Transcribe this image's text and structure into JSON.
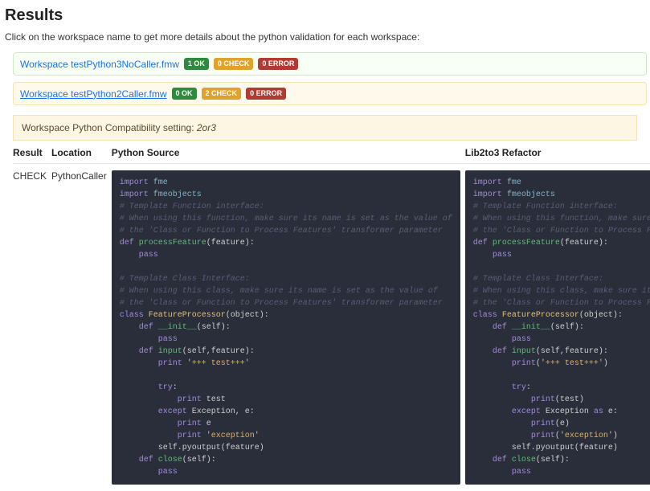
{
  "page": {
    "title": "Results",
    "subtitle": "Click on the workspace name to get more details about the python validation for each workspace:"
  },
  "workspaces": [
    {
      "name": "Workspace testPython3NoCaller.fmw",
      "ok": "1 OK",
      "check": "0 CHECK",
      "error": "0 ERROR",
      "style": "ok"
    },
    {
      "name": "Workspace testPython2Caller.fmw",
      "ok": "0 OK",
      "check": "2 CHECK",
      "error": "0 ERROR",
      "style": "warn"
    }
  ],
  "compat": {
    "label": "Workspace Python Compatibility setting: ",
    "value": "2or3"
  },
  "table": {
    "headers": {
      "result": "Result",
      "location": "Location",
      "source": "Python Source",
      "refactor": "Lib2to3 Refactor"
    },
    "rows": [
      {
        "result": "CHECK",
        "location": "PythonCaller",
        "source": [
          {
            "t": "key",
            "v": "import "
          },
          {
            "t": "mod",
            "v": "fme"
          },
          {
            "t": "nl"
          },
          {
            "t": "key",
            "v": "import "
          },
          {
            "t": "mod",
            "v": "fmeobjects"
          },
          {
            "t": "nl"
          },
          {
            "t": "com",
            "v": "# Template Function interface:"
          },
          {
            "t": "nl"
          },
          {
            "t": "com",
            "v": "# When using this function, make sure its name is set as the value of"
          },
          {
            "t": "nl"
          },
          {
            "t": "com",
            "v": "# the 'Class or Function to Process Features' transformer parameter"
          },
          {
            "t": "nl"
          },
          {
            "t": "def",
            "v": "def "
          },
          {
            "t": "fn",
            "v": "processFeature"
          },
          {
            "t": "",
            "v": "(feature):"
          },
          {
            "t": "nl"
          },
          {
            "t": "",
            "v": "    "
          },
          {
            "t": "key",
            "v": "pass"
          },
          {
            "t": "nl"
          },
          {
            "t": "nl"
          },
          {
            "t": "com",
            "v": "# Template Class Interface:"
          },
          {
            "t": "nl"
          },
          {
            "t": "com",
            "v": "# When using this class, make sure its name is set as the value of"
          },
          {
            "t": "nl"
          },
          {
            "t": "com",
            "v": "# the 'Class or Function to Process Features' transformer parameter"
          },
          {
            "t": "nl"
          },
          {
            "t": "key",
            "v": "class "
          },
          {
            "t": "cls",
            "v": "FeatureProcessor"
          },
          {
            "t": "",
            "v": "(object):"
          },
          {
            "t": "nl"
          },
          {
            "t": "",
            "v": "    "
          },
          {
            "t": "def",
            "v": "def "
          },
          {
            "t": "fn",
            "v": "__init__"
          },
          {
            "t": "",
            "v": "(self):"
          },
          {
            "t": "nl"
          },
          {
            "t": "",
            "v": "        "
          },
          {
            "t": "key",
            "v": "pass"
          },
          {
            "t": "nl"
          },
          {
            "t": "",
            "v": "    "
          },
          {
            "t": "def",
            "v": "def "
          },
          {
            "t": "fn",
            "v": "input"
          },
          {
            "t": "",
            "v": "(self,feature):"
          },
          {
            "t": "nl"
          },
          {
            "t": "",
            "v": "        "
          },
          {
            "t": "key",
            "v": "print "
          },
          {
            "t": "str",
            "v": "'+++ test+++'"
          },
          {
            "t": "nl"
          },
          {
            "t": "nl"
          },
          {
            "t": "",
            "v": "        "
          },
          {
            "t": "key",
            "v": "try"
          },
          {
            "t": "",
            "v": ":"
          },
          {
            "t": "nl"
          },
          {
            "t": "",
            "v": "            "
          },
          {
            "t": "key",
            "v": "print "
          },
          {
            "t": "",
            "v": "test"
          },
          {
            "t": "nl"
          },
          {
            "t": "",
            "v": "        "
          },
          {
            "t": "key",
            "v": "except"
          },
          {
            "t": "",
            "v": " Exception, e:"
          },
          {
            "t": "nl"
          },
          {
            "t": "",
            "v": "            "
          },
          {
            "t": "key",
            "v": "print "
          },
          {
            "t": "",
            "v": "e"
          },
          {
            "t": "nl"
          },
          {
            "t": "",
            "v": "            "
          },
          {
            "t": "key",
            "v": "print "
          },
          {
            "t": "str",
            "v": "'exception'"
          },
          {
            "t": "nl"
          },
          {
            "t": "",
            "v": "        self.pyoutput(feature)"
          },
          {
            "t": "nl"
          },
          {
            "t": "",
            "v": "    "
          },
          {
            "t": "def",
            "v": "def "
          },
          {
            "t": "fn",
            "v": "close"
          },
          {
            "t": "",
            "v": "(self):"
          },
          {
            "t": "nl"
          },
          {
            "t": "",
            "v": "        "
          },
          {
            "t": "key",
            "v": "pass"
          }
        ],
        "refactor": [
          {
            "t": "key",
            "v": "import "
          },
          {
            "t": "mod",
            "v": "fme"
          },
          {
            "t": "nl"
          },
          {
            "t": "key",
            "v": "import "
          },
          {
            "t": "mod",
            "v": "fmeobjects"
          },
          {
            "t": "nl"
          },
          {
            "t": "com",
            "v": "# Template Function interface:"
          },
          {
            "t": "nl"
          },
          {
            "t": "com",
            "v": "# When using this function, make sure its name is set as the value of"
          },
          {
            "t": "nl"
          },
          {
            "t": "com",
            "v": "# the 'Class or Function to Process Features' transformer parameter"
          },
          {
            "t": "nl"
          },
          {
            "t": "def",
            "v": "def "
          },
          {
            "t": "fn",
            "v": "processFeature"
          },
          {
            "t": "",
            "v": "(feature):"
          },
          {
            "t": "nl"
          },
          {
            "t": "",
            "v": "    "
          },
          {
            "t": "key",
            "v": "pass"
          },
          {
            "t": "nl"
          },
          {
            "t": "nl"
          },
          {
            "t": "com",
            "v": "# Template Class Interface:"
          },
          {
            "t": "nl"
          },
          {
            "t": "com",
            "v": "# When using this class, make sure its name is set as the value of"
          },
          {
            "t": "nl"
          },
          {
            "t": "com",
            "v": "# the 'Class or Function to Process Features' transformer parameter"
          },
          {
            "t": "nl"
          },
          {
            "t": "key",
            "v": "class "
          },
          {
            "t": "cls",
            "v": "FeatureProcessor"
          },
          {
            "t": "",
            "v": "(object):"
          },
          {
            "t": "nl"
          },
          {
            "t": "",
            "v": "    "
          },
          {
            "t": "def",
            "v": "def "
          },
          {
            "t": "fn",
            "v": "__init__"
          },
          {
            "t": "",
            "v": "(self):"
          },
          {
            "t": "nl"
          },
          {
            "t": "",
            "v": "        "
          },
          {
            "t": "key",
            "v": "pass"
          },
          {
            "t": "nl"
          },
          {
            "t": "",
            "v": "    "
          },
          {
            "t": "def",
            "v": "def "
          },
          {
            "t": "fn",
            "v": "input"
          },
          {
            "t": "",
            "v": "(self,feature):"
          },
          {
            "t": "nl"
          },
          {
            "t": "",
            "v": "        "
          },
          {
            "t": "key",
            "v": "print"
          },
          {
            "t": "",
            "v": "("
          },
          {
            "t": "str",
            "v": "'+++ test+++'"
          },
          {
            "t": "",
            "v": ")"
          },
          {
            "t": "nl"
          },
          {
            "t": "nl"
          },
          {
            "t": "",
            "v": "        "
          },
          {
            "t": "key",
            "v": "try"
          },
          {
            "t": "",
            "v": ":"
          },
          {
            "t": "nl"
          },
          {
            "t": "",
            "v": "            "
          },
          {
            "t": "key",
            "v": "print"
          },
          {
            "t": "",
            "v": "(test)"
          },
          {
            "t": "nl"
          },
          {
            "t": "",
            "v": "        "
          },
          {
            "t": "key",
            "v": "except"
          },
          {
            "t": "",
            "v": " Exception "
          },
          {
            "t": "key",
            "v": "as"
          },
          {
            "t": "",
            "v": " e:"
          },
          {
            "t": "nl"
          },
          {
            "t": "",
            "v": "            "
          },
          {
            "t": "key",
            "v": "print"
          },
          {
            "t": "",
            "v": "(e)"
          },
          {
            "t": "nl"
          },
          {
            "t": "",
            "v": "            "
          },
          {
            "t": "key",
            "v": "print"
          },
          {
            "t": "",
            "v": "("
          },
          {
            "t": "str",
            "v": "'exception'"
          },
          {
            "t": "",
            "v": ")"
          },
          {
            "t": "nl"
          },
          {
            "t": "",
            "v": "        self.pyoutput(feature)"
          },
          {
            "t": "nl"
          },
          {
            "t": "",
            "v": "    "
          },
          {
            "t": "def",
            "v": "def "
          },
          {
            "t": "fn",
            "v": "close"
          },
          {
            "t": "",
            "v": "(self):"
          },
          {
            "t": "nl"
          },
          {
            "t": "",
            "v": "        "
          },
          {
            "t": "key",
            "v": "pass"
          }
        ]
      }
    ]
  }
}
